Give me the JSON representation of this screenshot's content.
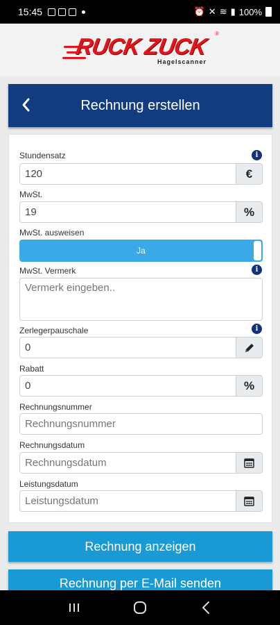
{
  "status_bar": {
    "time": "15:45",
    "battery": "100%"
  },
  "logo": {
    "brand": "RUCK ZUCK",
    "sub": "Hagelscanner",
    "reg": "®"
  },
  "header": {
    "title": "Rechnung erstellen"
  },
  "form": {
    "stundensatz": {
      "label": "Stundensatz",
      "value": "120",
      "addon": "€"
    },
    "mwst": {
      "label": "MwSt.",
      "value": "19",
      "addon": "%"
    },
    "mwst_ausweisen": {
      "label": "MwSt. ausweisen",
      "value": "Ja"
    },
    "mwst_vermerk": {
      "label": "MwSt. Vermerk",
      "placeholder": "Vermerk eingeben.."
    },
    "zerlegerpauschale": {
      "label": "Zerlegerpauschale",
      "value": "0"
    },
    "rabatt": {
      "label": "Rabatt",
      "value": "0",
      "addon": "%"
    },
    "rechnungsnummer": {
      "label": "Rechnungsnummer",
      "placeholder": "Rechnungsnummer"
    },
    "rechnungsdatum": {
      "label": "Rechnungsdatum",
      "placeholder": "Rechnungsdatum"
    },
    "leistungsdatum": {
      "label": "Leistungsdatum",
      "placeholder": "Leistungsdatum"
    }
  },
  "buttons": {
    "anzeigen": "Rechnung anzeigen",
    "email": "Rechnung per E-Mail senden"
  },
  "colors": {
    "header": "#133c80",
    "button": "#189ad6",
    "toggle": "#3aa9e6",
    "logo": "#e3141b"
  },
  "icons": {
    "back": "chevron-left-icon",
    "info": "info-icon",
    "edit": "pencil-icon",
    "date": "calendar-icon"
  }
}
